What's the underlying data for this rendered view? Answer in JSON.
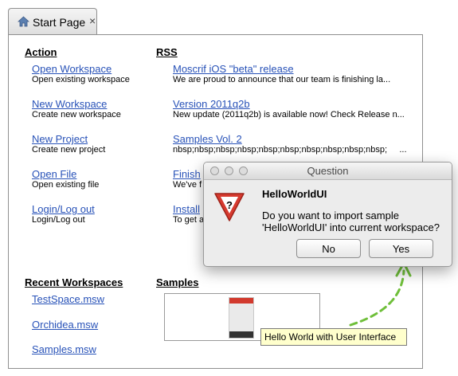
{
  "tab": {
    "title": "Start Page",
    "close": "×"
  },
  "action": {
    "heading": "Action",
    "items": [
      {
        "label": "Open Workspace",
        "desc": "Open existing workspace"
      },
      {
        "label": "New Workspace",
        "desc": "Create new workspace"
      },
      {
        "label": "New Project",
        "desc": "Create new project"
      },
      {
        "label": "Open File",
        "desc": "Open existing file"
      },
      {
        "label": "Login/Log out",
        "desc": "Login/Log out"
      }
    ]
  },
  "rss": {
    "heading": "RSS",
    "items": [
      {
        "label": "Moscrif iOS \"beta\" release",
        "desc": "We are proud to announce that our team is finishing la..."
      },
      {
        "label": "Version 2011q2b",
        "desc": "New update (2011q2b) is available now! Check Release n..."
      },
      {
        "label": "Samples Vol. 2",
        "desc": "nbsp;nbsp;nbsp;nbsp;nbsp;nbsp;nbsp;nbsp;nbsp;nbsp;     ..."
      },
      {
        "label": "Finish",
        "desc": "We've f"
      },
      {
        "label": "Install",
        "desc": "To get a"
      }
    ]
  },
  "recent": {
    "heading": "Recent Workspaces",
    "items": [
      "TestSpace.msw",
      "Orchidea.msw",
      "Samples.msw"
    ]
  },
  "samples": {
    "heading": "Samples",
    "tooltip": "Hello World with User Interface"
  },
  "dialog": {
    "title": "Question",
    "heading": "HelloWorldUI",
    "message_line1": "Do you want to import sample",
    "message_line2": "'HelloWorldUI' into current workspace?",
    "no_label": "No",
    "yes_label": "Yes",
    "icon_glyph": "?"
  },
  "colors": {
    "link": "#2852b8",
    "warning_red": "#d63a2f",
    "arrow_green": "#6fbf3a",
    "tooltip_bg": "#ffffcc"
  }
}
